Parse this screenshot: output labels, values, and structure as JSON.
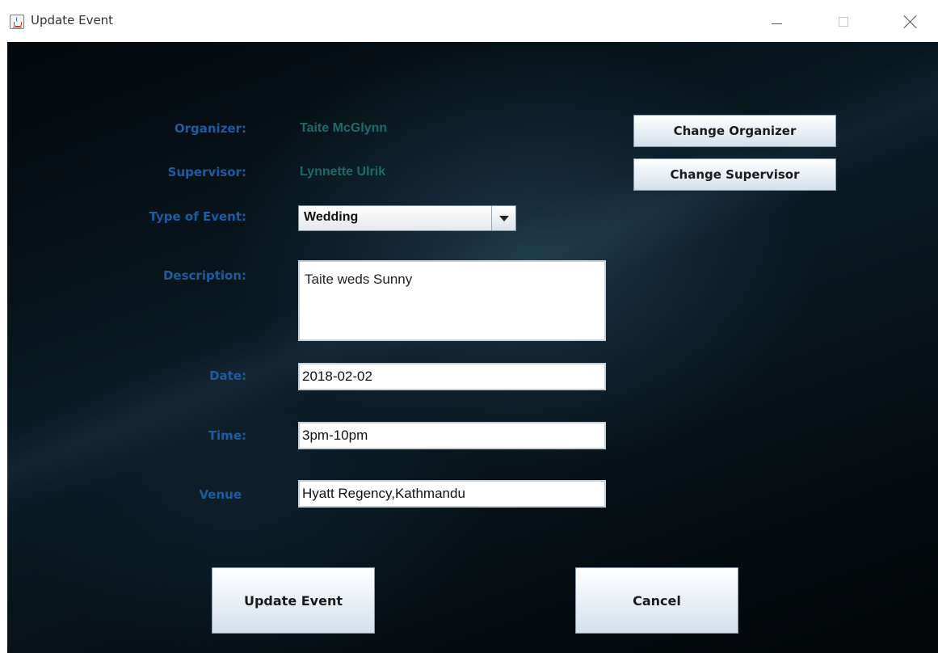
{
  "window": {
    "title": "Update Event",
    "icon": "java-cup-icon"
  },
  "form": {
    "organizer_label": "Organizer:",
    "organizer_value": "Taite McGlynn",
    "change_organizer_label": "Change Organizer",
    "supervisor_label": "Supervisor:",
    "supervisor_value": "Lynnette Ulrik",
    "change_supervisor_label": "Change Supervisor",
    "event_type_label": "Type of Event:",
    "event_type_value": "Wedding",
    "description_label": "Description:",
    "description_value": "Taite weds Sunny",
    "date_label": "Date:",
    "date_value": "2018-02-02",
    "time_label": "Time:",
    "time_value": "3pm-10pm",
    "venue_label": "Venue",
    "venue_value": "Hyatt Regency,Kathmandu"
  },
  "actions": {
    "update_label": "Update Event",
    "cancel_label": "Cancel"
  },
  "colors": {
    "label": "#1d5c9e",
    "value": "#1c6b6b"
  }
}
